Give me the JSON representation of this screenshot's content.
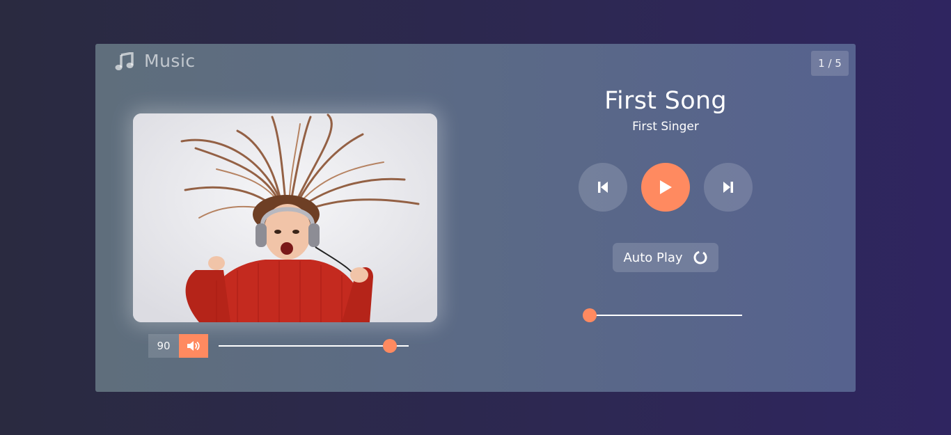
{
  "app": {
    "title": "Music",
    "icon": "music-note-icon",
    "track_counter": "1 / 5"
  },
  "song": {
    "title": "First Song",
    "artist": "First Singer",
    "cover_icon": "album-cover-image"
  },
  "controls": {
    "previous_icon": "skip-previous-icon",
    "play_icon": "play-icon",
    "next_icon": "skip-next-icon"
  },
  "autoplay": {
    "label": "Auto Play",
    "icon": "loading-ring-icon"
  },
  "volume": {
    "value": "90",
    "level": 0.9,
    "icon": "volume-icon"
  },
  "progress": {
    "level": 0.0
  },
  "colors": {
    "accent": "#ff8a60",
    "panel": "#5b6a86",
    "background": "#2d2852"
  }
}
